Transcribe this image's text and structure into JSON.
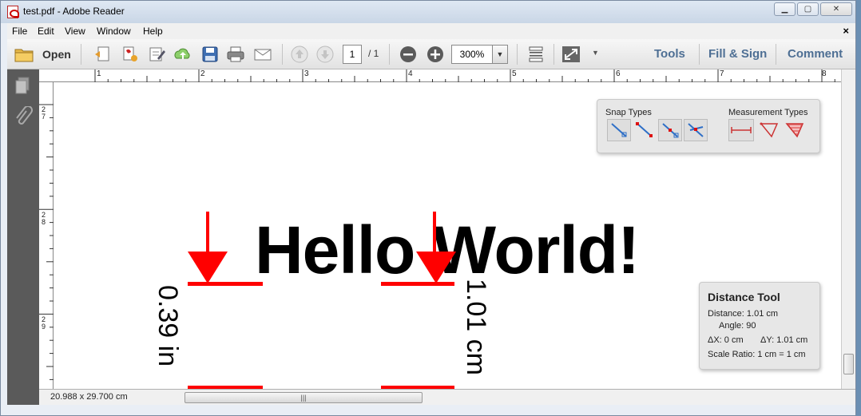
{
  "window": {
    "title": "test.pdf - Adobe Reader"
  },
  "menu": {
    "items": [
      "File",
      "Edit",
      "View",
      "Window",
      "Help"
    ],
    "close": "×"
  },
  "toolbar": {
    "open_label": "Open",
    "page_current": "1",
    "page_total": "/ 1",
    "zoom": "300%",
    "tools_label": "Tools",
    "fill_sign_label": "Fill & Sign",
    "comment_label": "Comment"
  },
  "ruler": {
    "h_numbers": [
      "1",
      "2",
      "3",
      "4",
      "5",
      "6",
      "7",
      "8"
    ],
    "v_numbers": [
      "2\n7",
      "2\n8",
      "2\n9"
    ]
  },
  "document": {
    "text": "Hello World!",
    "measure_left": "0.39 in",
    "measure_right": "1.01 cm",
    "marker_color": "#ff0000"
  },
  "snap_panel": {
    "snap_title": "Snap Types",
    "measure_title": "Measurement Types",
    "snap_icons": [
      "snap-to-paths-icon",
      "snap-to-endpoints-icon",
      "snap-to-midpoints-icon",
      "snap-to-intersections-icon"
    ],
    "measure_icons": [
      "distance-tool-icon",
      "perimeter-tool-icon",
      "area-tool-icon"
    ]
  },
  "distance_tool": {
    "title": "Distance Tool",
    "distance": "Distance: 1.01 cm",
    "angle": "Angle: 90",
    "dx": "ΔX: 0 cm",
    "dy": "ΔY: 1.01 cm",
    "scale": "Scale Ratio: 1 cm = 1 cm"
  },
  "status": {
    "page_size": "20.988 x 29.700 cm"
  }
}
